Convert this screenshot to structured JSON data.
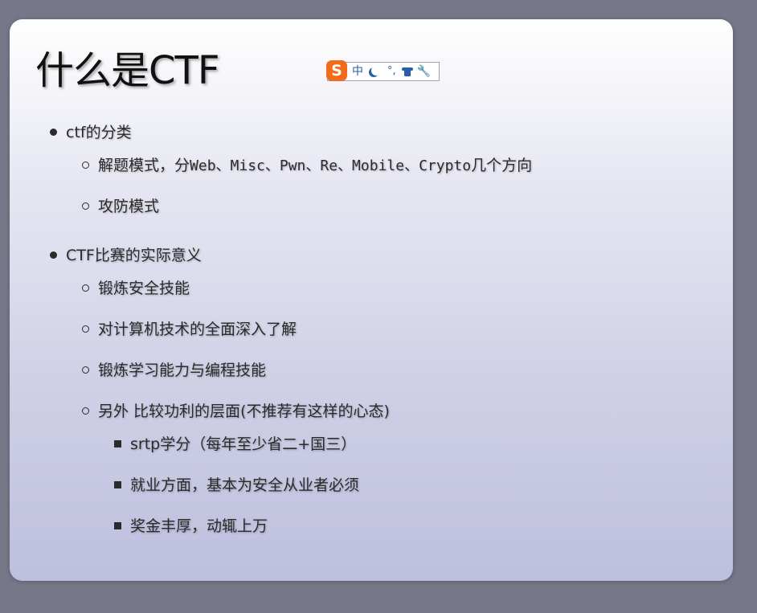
{
  "slide": {
    "title": "什么是CTF"
  },
  "ime_toolbar": {
    "logo": "S",
    "mode": "中",
    "punct": "°,",
    "icons": [
      "moon-icon",
      "punctuation-icon",
      "skin-icon",
      "wrench-icon"
    ]
  },
  "content": {
    "section1": {
      "label": "ctf的分类",
      "items": [
        {
          "prefix": "解题模式，分",
          "mono": "Web、Misc、Pwn、Re、Mobile、Crypto",
          "suffix": "几个方向"
        },
        {
          "label": "攻防模式"
        }
      ]
    },
    "section2": {
      "label": "CTF比赛的实际意义",
      "items": [
        "锻炼安全技能",
        "对计算机技术的全面深入了解",
        "锻炼学习能力与编程技能",
        "另外 比较功利的层面(不推荐有这样的心态)"
      ],
      "sub_items": [
        "srtp学分（每年至少省二+国三）",
        "就业方面，基本为安全从业者必须",
        "奖金丰厚，动辄上万"
      ]
    }
  }
}
